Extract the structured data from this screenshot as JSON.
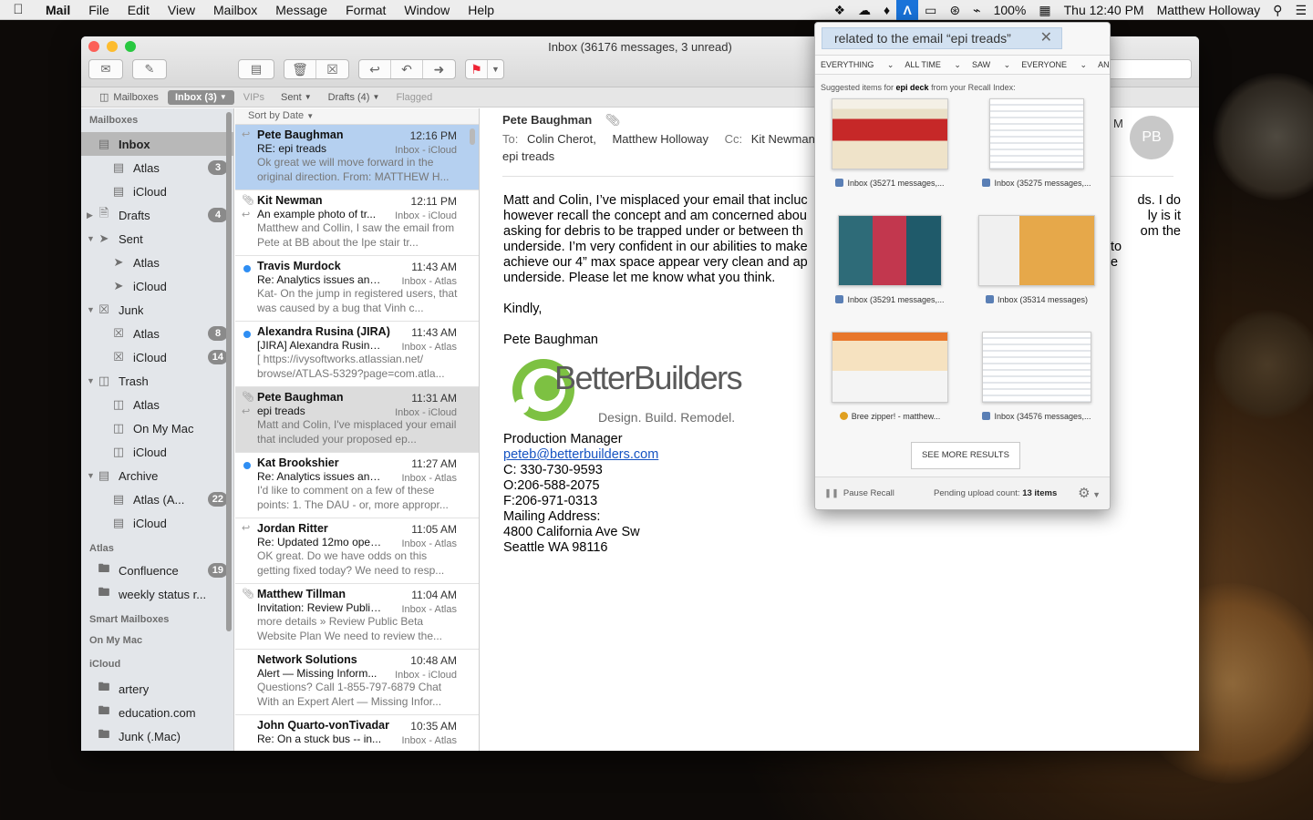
{
  "menubar": {
    "app": "Mail",
    "items": [
      "File",
      "Edit",
      "View",
      "Mailbox",
      "Message",
      "Format",
      "Window",
      "Help"
    ],
    "battery": "100%",
    "clock": "Thu 12:40 PM",
    "user": "Matthew Holloway"
  },
  "window": {
    "title": "Inbox (36176 messages, 3 unread)"
  },
  "favorites": {
    "mailboxes": "Mailboxes",
    "inbox": "Inbox (3)",
    "vips": "VIPs",
    "sent": "Sent",
    "drafts": "Drafts (4)",
    "flagged": "Flagged"
  },
  "sidebar": {
    "mailboxes_header": "Mailboxes",
    "rows": [
      {
        "label": "Inbox",
        "badge": ""
      },
      {
        "label": "Atlas",
        "badge": "3"
      },
      {
        "label": "iCloud",
        "badge": ""
      },
      {
        "label": "Drafts",
        "badge": "4"
      },
      {
        "label": "Sent",
        "badge": ""
      },
      {
        "label": "Atlas",
        "badge": ""
      },
      {
        "label": "iCloud",
        "badge": ""
      },
      {
        "label": "Junk",
        "badge": ""
      },
      {
        "label": "Atlas",
        "badge": "8"
      },
      {
        "label": "iCloud",
        "badge": "14"
      },
      {
        "label": "Trash",
        "badge": ""
      },
      {
        "label": "Atlas",
        "badge": ""
      },
      {
        "label": "On My Mac",
        "badge": ""
      },
      {
        "label": "iCloud",
        "badge": ""
      },
      {
        "label": "Archive",
        "badge": ""
      },
      {
        "label": "Atlas (A...",
        "badge": "22"
      },
      {
        "label": "iCloud",
        "badge": ""
      }
    ],
    "atlas_header": "Atlas",
    "atlas_rows": [
      {
        "label": "Confluence",
        "badge": "19"
      },
      {
        "label": "weekly status r...",
        "badge": ""
      }
    ],
    "smart_header": "Smart Mailboxes",
    "onmymac_header": "On My Mac",
    "icloud_header": "iCloud",
    "icloud_rows": [
      {
        "label": "artery"
      },
      {
        "label": "education.com"
      },
      {
        "label": "Junk (.Mac)"
      }
    ]
  },
  "messagelist": {
    "sort": "Sort by Date",
    "messages": [
      {
        "from": "Pete Baughman",
        "time": "12:16 PM",
        "subject": "RE: epi treads",
        "mailbox": "Inbox - iCloud",
        "preview": "Ok great we will move forward in the original direction. From: MATTHEW H..."
      },
      {
        "from": "Kit Newman",
        "time": "12:11 PM",
        "subject": "An example photo of tr...",
        "mailbox": "Inbox - iCloud",
        "preview": "Matthew and Collin, I saw the email from Pete at BB about the Ipe stair tr..."
      },
      {
        "from": "Travis Murdock",
        "time": "11:43 AM",
        "subject": "Re: Analytics issues and...",
        "mailbox": "Inbox - Atlas",
        "preview": "Kat- On the jump in registered users, that was caused by a bug that Vinh c..."
      },
      {
        "from": "Alexandra Rusina (JIRA)",
        "time": "11:43 AM",
        "subject": "[JIRA] Alexandra Rusina...",
        "mailbox": "Inbox - Atlas",
        "preview": "[ https://ivysoftworks.atlassian.net/ browse/ATLAS-5329?page=com.atla..."
      },
      {
        "from": "Pete Baughman",
        "time": "11:31 AM",
        "subject": "epi treads",
        "mailbox": "Inbox - iCloud",
        "preview": "Matt and Colin, I've misplaced your email that included your proposed ep..."
      },
      {
        "from": "Kat Brookshier",
        "time": "11:27 AM",
        "subject": "Re: Analytics issues and...",
        "mailbox": "Inbox - Atlas",
        "preview": "I'd like to comment on a few of these points: 1. The DAU - or, more appropr..."
      },
      {
        "from": "Jordan Ritter",
        "time": "11:05 AM",
        "subject": "Re: Updated 12mo opera...",
        "mailbox": "Inbox - Atlas",
        "preview": "OK great. Do we have odds on this getting fixed today? We need to resp..."
      },
      {
        "from": "Matthew Tillman",
        "time": "11:04 AM",
        "subject": "Invitation: Review Public...",
        "mailbox": "Inbox - Atlas",
        "preview": "more details » Review Public Beta Website Plan We need to review the..."
      },
      {
        "from": "Network Solutions",
        "time": "10:48 AM",
        "subject": "Alert — Missing Inform...",
        "mailbox": "Inbox - iCloud",
        "preview": "Questions? Call 1-855-797-6879 Chat With an Expert Alert — Missing Infor..."
      },
      {
        "from": "John Quarto-vonTivadar",
        "time": "10:35 AM",
        "subject": "Re: On a stuck bus -- in...",
        "mailbox": "Inbox - Atlas",
        "preview": ""
      }
    ]
  },
  "reader": {
    "sender": "Pete Baughman",
    "to_label": "To:",
    "to1": "Colin Cherot,",
    "to2": "Matthew Holloway",
    "cc_label": "Cc:",
    "cc1": "Kit Newman,",
    "subject": "epi treads",
    "avatar": "PB",
    "partial_right_1": "M",
    "partial_right_2": "ds. I do",
    "partial_right_3": "ly is it",
    "partial_right_4": "om the",
    "partial_right_5": "to",
    "partial_right_6": "e",
    "body_l1": "Matt and Colin, I’ve misplaced your email that incluc",
    "body_l2": "however recall the concept and am concerned abou",
    "body_l3": "asking for debris to be trapped under or between th",
    "body_l4": "underside. I’m very confident in our abilities to make",
    "body_l5": "achieve our 4” max space appear very clean and ap",
    "body_l6": "underside. Please let me know what you think.",
    "closing": "Kindly,",
    "sig_name": "Pete Baughman",
    "logo_text": "BetterBuilders",
    "logo_tag": "Design. Build. Remodel.",
    "title": "Production Manager",
    "email": "peteb@betterbuilders.com",
    "cell": "C: 330-730-9593",
    "office": "O:206-588-2075",
    "fax": "F:206-971-0313",
    "mail_label": "Mailing Address:",
    "addr1": "4800 California Ave Sw",
    "addr2": "Seattle WA 98116"
  },
  "recall": {
    "query": "related to the email “epi treads”",
    "filters": [
      "EVERYTHING",
      "ALL TIME",
      "SAW",
      "EVERYONE",
      "ANY LOCATION"
    ],
    "sugg_prefix": "Suggested items for ",
    "sugg_term": "epi deck",
    "sugg_suffix": " from your Recall Index:",
    "results": [
      {
        "caption": "Inbox (35271 messages,...",
        "icon_color": "#5a7fb5"
      },
      {
        "caption": "Inbox (35275 messages,...",
        "icon_color": "#5a7fb5"
      },
      {
        "caption": "Inbox (35291 messages,...",
        "icon_color": "#5a7fb5"
      },
      {
        "caption": "Inbox (35314 messages)",
        "icon_color": "#5a7fb5"
      },
      {
        "caption": "Bree zipper! - matthew...",
        "icon_color": "#e0a020"
      },
      {
        "caption": "Inbox (34576 messages,...",
        "icon_color": "#5a7fb5"
      }
    ],
    "see_more": "SEE MORE RESULTS",
    "pause": "Pause Recall",
    "pending_label": "Pending upload count: ",
    "pending_count": "13 items"
  },
  "colors": {
    "selection_blue": "#b5d0f0",
    "unread_dot": "#2f8ef3",
    "recall_accent": "#1a73d9",
    "link": "#1553c2",
    "logo_green": "#7dc142"
  }
}
